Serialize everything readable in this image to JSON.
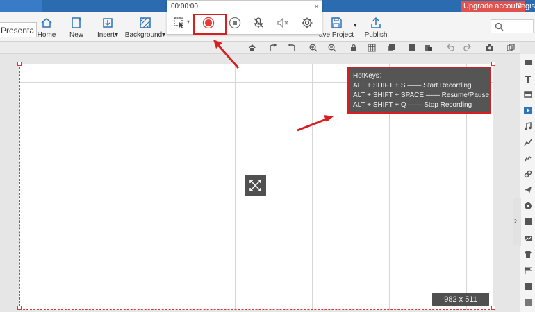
{
  "app": {
    "upgrade_label": "Upgrade account",
    "register_label": "Regist"
  },
  "ribbon": {
    "tab_stub": "Presenta",
    "buttons": [
      {
        "label": "Home",
        "icon": "home-icon"
      },
      {
        "label": "New",
        "icon": "new-slide-icon"
      },
      {
        "label": "Insert",
        "icon": "insert-icon"
      },
      {
        "label": "Background",
        "icon": "background-icon"
      },
      {
        "label": "ave Project",
        "icon": "save-icon"
      },
      {
        "label": "Publish",
        "icon": "publish-icon"
      }
    ]
  },
  "recorder": {
    "time": "00:00:00",
    "close": "×",
    "tools": [
      "region-select-icon",
      "record-icon",
      "stop-icon",
      "microphone-muted-icon",
      "speaker-muted-icon",
      "settings-icon"
    ]
  },
  "hotkeys": {
    "title": "HotKeys：",
    "lines": [
      "ALT + SHIFT + S —— Start Recording",
      "ALT + SHIFT + SPACE —— Resume/Pause",
      "ALT + SHIFT + Q —— Stop Recording"
    ]
  },
  "canvas": {
    "dimensions": "982 x 511"
  },
  "colors": {
    "accent_red": "#d81f1f",
    "title_blue": "#2b6cb0",
    "record_red": "#e53935"
  }
}
